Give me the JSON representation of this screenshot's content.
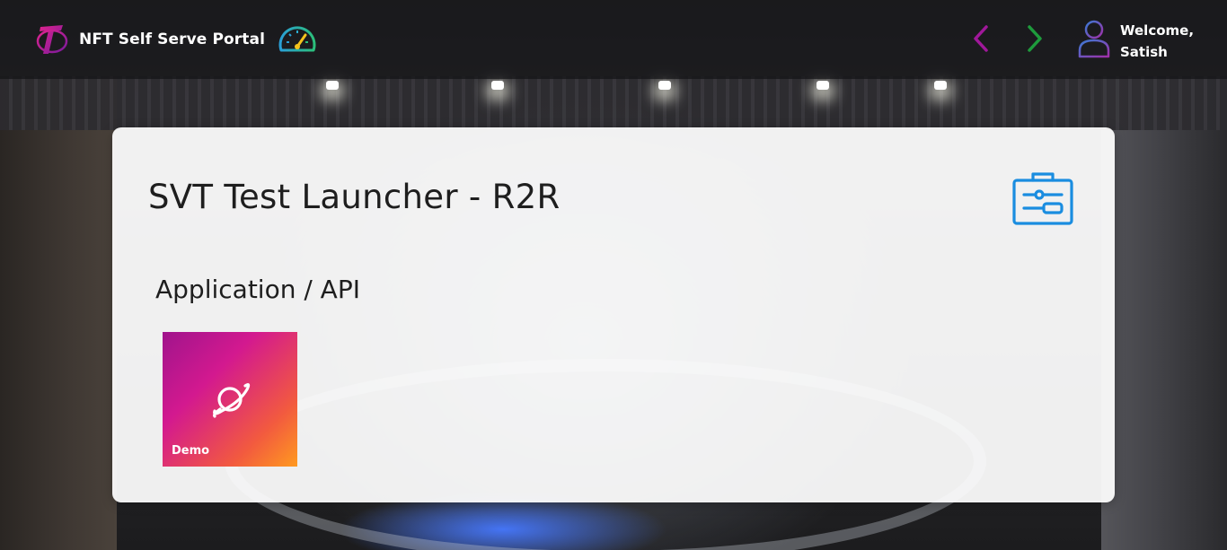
{
  "header": {
    "app_name": "NFT Self Serve Portal",
    "welcome_line1": "Welcome,",
    "welcome_line2": "Satish",
    "icons": {
      "logo": "telstra-logo-icon",
      "dashboard": "speedometer-icon",
      "back": "chevron-left-icon",
      "forward": "chevron-right-icon",
      "user": "user-icon"
    }
  },
  "main": {
    "title": "SVT Test Launcher - R2R",
    "title_icon": "toolbox-icon",
    "section_title": "Application / API",
    "tiles": [
      {
        "label": "Demo",
        "icon": "planet-icon"
      }
    ]
  },
  "colors": {
    "brand_magenta": "#b5179e",
    "nav_back": "#a0189a",
    "nav_forward": "#1e9b3c",
    "accent_blue": "#1a8de0",
    "tile_gradient_start": "#a0148c",
    "tile_gradient_end": "#ff9a1f"
  }
}
